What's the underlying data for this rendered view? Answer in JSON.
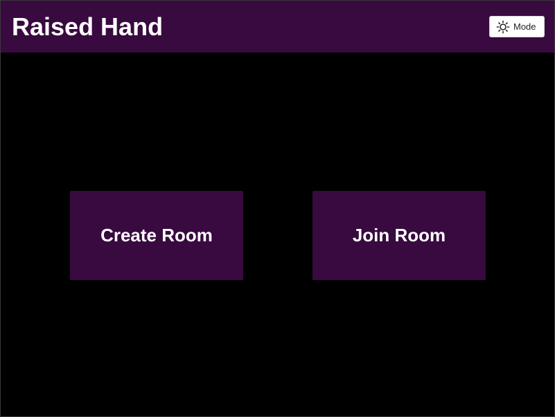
{
  "header": {
    "title": "Raised Hand",
    "mode_button": {
      "label": "Mode",
      "icon": "sun-icon"
    }
  },
  "main": {
    "create_room_label": "Create Room",
    "join_room_label": "Join Room"
  },
  "colors": {
    "brand": "#380a3f",
    "background": "#000000",
    "text": "#ffffff"
  }
}
